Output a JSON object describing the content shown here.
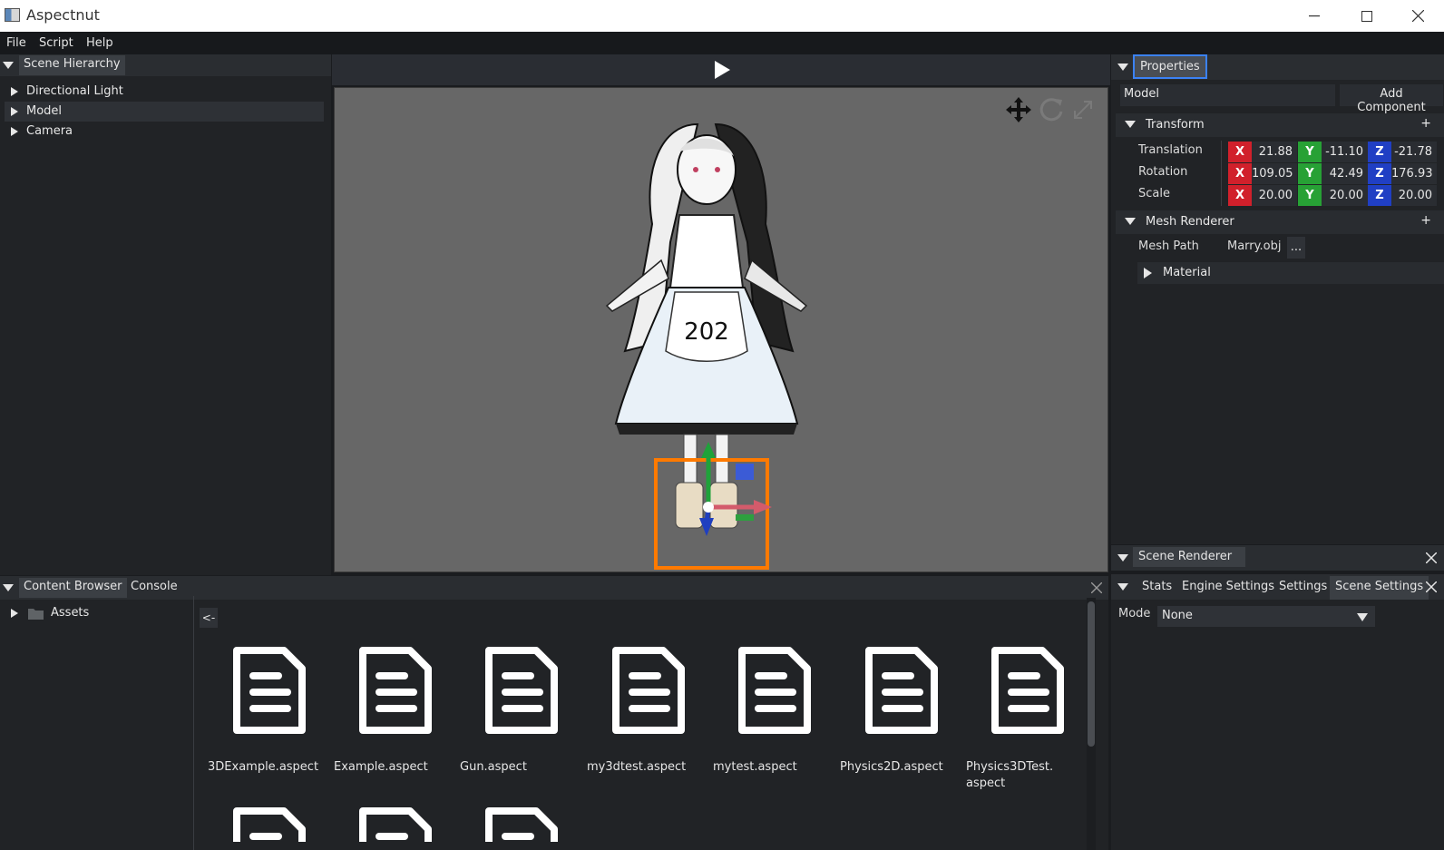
{
  "window": {
    "title": "Aspectnut",
    "minimize_icon": "minimize-icon",
    "maximize_icon": "maximize-icon",
    "close_icon": "close-icon"
  },
  "menu": [
    "File",
    "Script",
    "Help"
  ],
  "scene_hierarchy": {
    "tab": "Scene Hierarchy",
    "items": [
      {
        "label": "Directional Light",
        "selected": false
      },
      {
        "label": "Model",
        "selected": true
      },
      {
        "label": "Camera",
        "selected": false
      }
    ]
  },
  "viewport": {
    "play_icon": "play-icon",
    "gizmo_tools": [
      "move-icon",
      "rotate-icon",
      "scale-icon"
    ],
    "model_text": "202"
  },
  "properties": {
    "tab": "Properties",
    "entity_name": "Model",
    "add_component": "Add Component",
    "transform": {
      "title": "Transform",
      "add": "+",
      "rows": [
        {
          "label": "Translation",
          "x": "21.88",
          "y": "-11.10",
          "z": "-21.78"
        },
        {
          "label": "Rotation",
          "x": "109.05",
          "y": "42.49",
          "z": "176.93"
        },
        {
          "label": "Scale",
          "x": "20.00",
          "y": "20.00",
          "z": "20.00"
        }
      ],
      "axis_labels": {
        "x": "X",
        "y": "Y",
        "z": "Z"
      }
    },
    "mesh_renderer": {
      "title": "Mesh Renderer",
      "add": "+",
      "mesh_path_label": "Mesh Path",
      "mesh_path_value": "Marry.obj",
      "browse": "...",
      "material": "Material"
    }
  },
  "scene_renderer": {
    "tab": "Scene Renderer"
  },
  "settings_panel": {
    "tabs": [
      "Stats",
      "Engine Settings",
      "Settings",
      "Scene Settings"
    ],
    "mode_label": "Mode",
    "mode_value": "None"
  },
  "content_browser": {
    "tabs": [
      "Content Browser",
      "Console"
    ],
    "tree_root": "Assets",
    "back_button": "<-",
    "files": [
      "3DExample.aspect",
      "Example.aspect",
      "Gun.aspect",
      "my3dtest.aspect",
      "mytest.aspect",
      "Physics2D.aspect",
      "Physics3DTest.\naspect"
    ]
  },
  "colors": {
    "accent": "#3b82f6",
    "selection_box": "#ff7a00",
    "x_axis": "#d1202b",
    "y_axis": "#27a135",
    "z_axis": "#203fc4"
  }
}
